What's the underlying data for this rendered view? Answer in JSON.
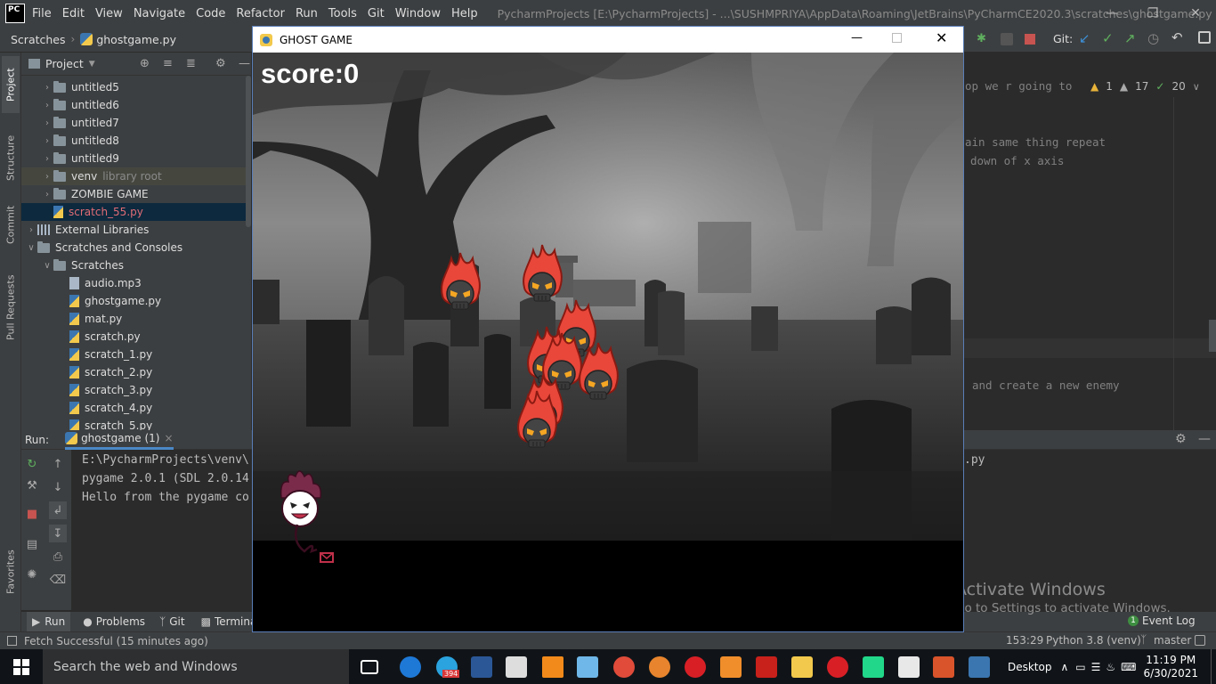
{
  "ide": {
    "logo": "PC",
    "menu": [
      "File",
      "Edit",
      "View",
      "Navigate",
      "Code",
      "Refactor",
      "Run",
      "Tools",
      "Git",
      "Window",
      "Help"
    ],
    "title": "PycharmProjects [E:\\PycharmProjects] - ...\\SUSHMPRIYA\\AppData\\Roaming\\JetBrains\\PyCharmCE2020.3\\scratches\\ghostgame.py",
    "breadcrumb": [
      "Scratches",
      "ghostgame.py"
    ],
    "git_label": "Git:"
  },
  "left_strip": {
    "tabs": [
      "Project",
      "Structure",
      "Commit",
      "Pull Requests",
      "Favorites"
    ]
  },
  "project_panel": {
    "header": "Project",
    "rows": [
      {
        "label": "untitled5",
        "kind": "folder",
        "indent": 1
      },
      {
        "label": "untitled6",
        "kind": "folder",
        "indent": 1
      },
      {
        "label": "untitled7",
        "kind": "folder",
        "indent": 1
      },
      {
        "label": "untitled8",
        "kind": "folder",
        "indent": 1
      },
      {
        "label": "untitled9",
        "kind": "folder",
        "indent": 1
      },
      {
        "label": "venv",
        "note": "library root",
        "kind": "folder",
        "indent": 1
      },
      {
        "label": "ZOMBIE GAME",
        "kind": "folder",
        "indent": 1
      },
      {
        "label": "scratch_55.py",
        "kind": "py",
        "indent": 1
      },
      {
        "label": "External Libraries",
        "kind": "lib",
        "indent": 0
      },
      {
        "label": "Scratches and Consoles",
        "kind": "folder",
        "indent": 0
      },
      {
        "label": "Scratches",
        "kind": "folder",
        "indent": 1
      },
      {
        "label": "audio.mp3",
        "kind": "mp3",
        "indent": 2
      },
      {
        "label": "ghostgame.py",
        "kind": "py",
        "indent": 2
      },
      {
        "label": "mat.py",
        "kind": "py",
        "indent": 2
      },
      {
        "label": "scratch.py",
        "kind": "py",
        "indent": 2
      },
      {
        "label": "scratch_1.py",
        "kind": "py",
        "indent": 2
      },
      {
        "label": "scratch_2.py",
        "kind": "py",
        "indent": 2
      },
      {
        "label": "scratch_3.py",
        "kind": "py",
        "indent": 2
      },
      {
        "label": "scratch_4.py",
        "kind": "py",
        "indent": 2
      },
      {
        "label": "scratch_5.py",
        "kind": "py",
        "indent": 2
      }
    ]
  },
  "editor": {
    "lines": [
      "op we r going to",
      "ain same thing repeat",
      "down of x axis",
      "and create a new enemy"
    ],
    "inspections": {
      "warnings": "1",
      "weak_warnings": "17",
      "typos": "20"
    }
  },
  "run_panel": {
    "label": "Run:",
    "tab": "ghostgame (1)",
    "console": [
      "E:\\PycharmProjects\\venv\\",
      "pygame 2.0.1 (SDL 2.0.14",
      "Hello from the pygame co"
    ],
    "console_right": ".py"
  },
  "bottom_tabs": [
    "Run",
    "Problems",
    "Git",
    "Terminal"
  ],
  "event_log": {
    "count": "1",
    "label": "Event Log"
  },
  "status": {
    "message": "Fetch Successful (15 minutes ago)",
    "position": "153:29",
    "interpreter": "Python 3.8 (venv)",
    "branch": "master"
  },
  "watermark": {
    "title": "Activate Windows",
    "subtitle": "Go to Settings to activate Windows."
  },
  "game": {
    "window_title": "GHOST GAME",
    "score_text": "score:0"
  },
  "taskbar": {
    "search_placeholder": "Search the web and Windows",
    "telegram_badge": "394",
    "desktop_label": "Desktop",
    "time": "11:19 PM",
    "date": "6/30/2021"
  },
  "colors": {
    "ide_bg": "#2b2b2b",
    "panel_bg": "#3c3f41",
    "selection": "#0d293e",
    "skull_flame": "#e8473a",
    "taskbar": "#101418"
  }
}
